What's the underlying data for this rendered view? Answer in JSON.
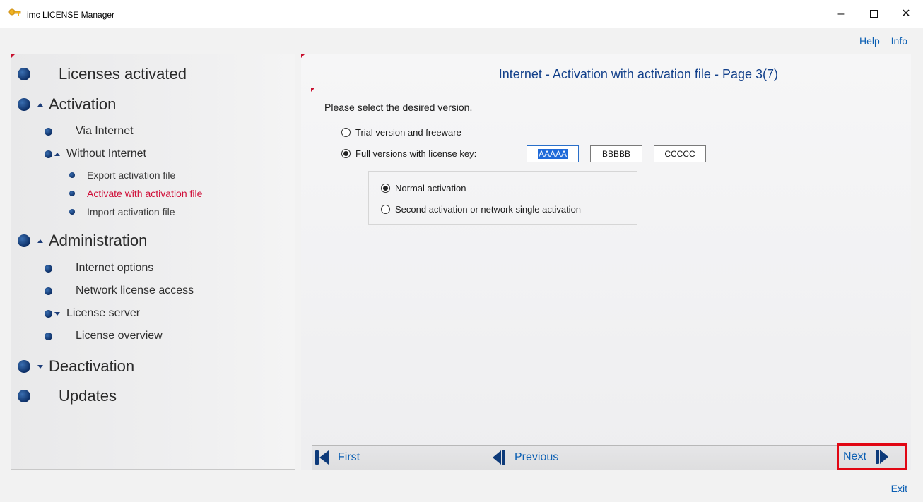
{
  "window": {
    "title": "imc LICENSE Manager",
    "controls": {
      "minimize": "–",
      "maximize": "□",
      "close": "✕"
    }
  },
  "toplinks": {
    "help": "Help",
    "info": "Info"
  },
  "nav": {
    "licenses_activated": "Licenses activated",
    "activation": "Activation",
    "via_internet": "Via Internet",
    "without_internet": "Without Internet",
    "export_activation_file": "Export activation file",
    "activate_with_activation_file": "Activate with activation file",
    "import_activation_file": "Import activation file",
    "administration": "Administration",
    "internet_options": "Internet options",
    "network_license_access": "Network license access",
    "license_server": "License server",
    "license_overview": "License overview",
    "deactivation": "Deactivation",
    "updates": "Updates"
  },
  "main": {
    "title": "Internet - Activation with activation file - Page 3(7)",
    "prompt": "Please select the desired version.",
    "option_trial": "Trial version and freeware",
    "option_full": "Full versions with license key:",
    "key1": "AAAAA",
    "key2": "BBBBB",
    "key3": "CCCCC",
    "option_normal": "Normal activation",
    "option_second": "Second activation or network single activation"
  },
  "bottom": {
    "first": "First",
    "previous": "Previous",
    "next": "Next"
  },
  "footer": {
    "exit": "Exit"
  },
  "colors": {
    "accent": "#0b5fb3",
    "active_nav": "#d0103a",
    "highlight_border": "#e10613",
    "title_blue": "#12408a"
  }
}
